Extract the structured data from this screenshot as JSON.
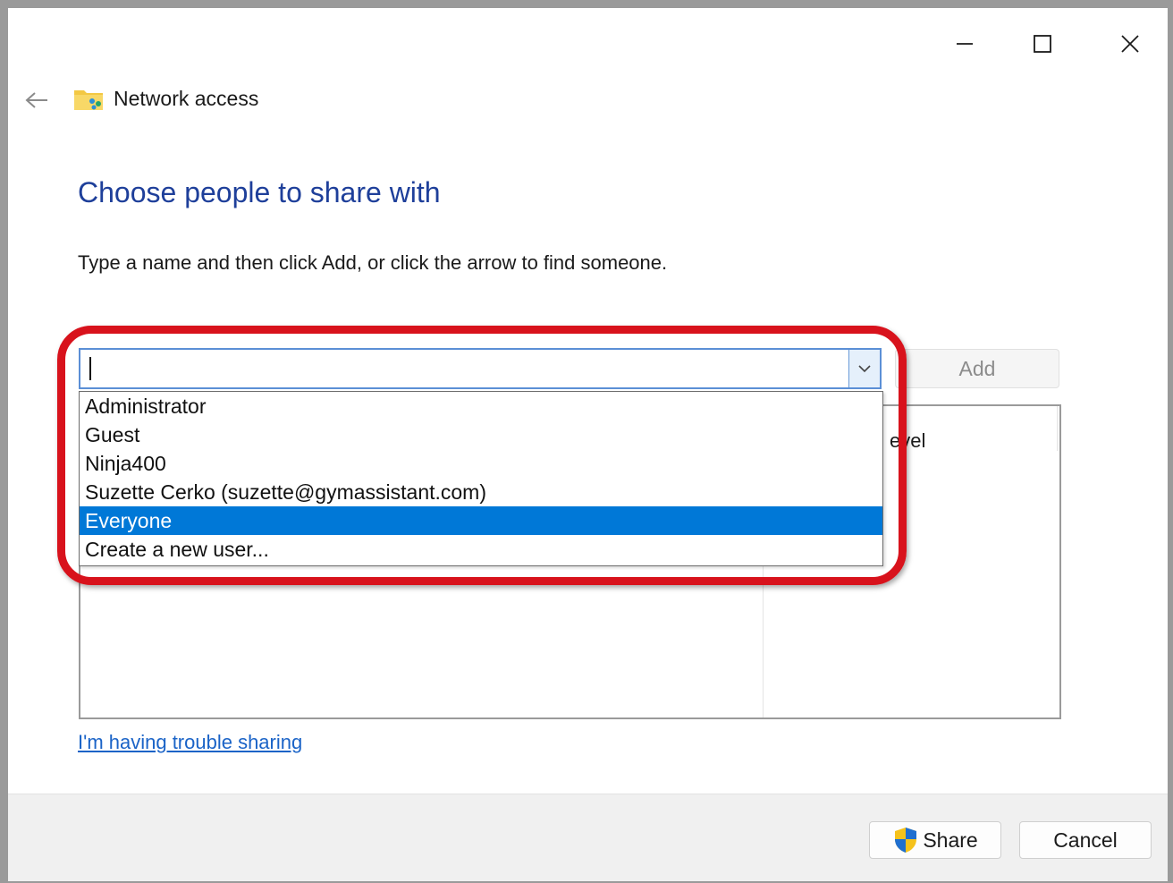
{
  "window": {
    "title": "Network access",
    "controls": {
      "minimize_icon": "minimize-icon",
      "maximize_icon": "maximize-icon",
      "close_icon": "close-icon"
    }
  },
  "nav": {
    "back_icon": "back-arrow-icon"
  },
  "main": {
    "heading": "Choose people to share with",
    "instruction": "Type a name and then click Add, or click the arrow to find someone.",
    "name_input": {
      "value": "",
      "placeholder": ""
    },
    "add_label": "Add",
    "dropdown_items": [
      {
        "label": "Administrator",
        "selected": false
      },
      {
        "label": "Guest",
        "selected": false
      },
      {
        "label": "Ninja400",
        "selected": false
      },
      {
        "label": "Suzette Cerko (suzette@gymassistant.com)",
        "selected": false
      },
      {
        "label": "Everyone",
        "selected": true
      },
      {
        "label": "Create a new user...",
        "selected": false
      }
    ],
    "permission_header_partial": "evel",
    "trouble_link": "I'm having trouble sharing"
  },
  "footer": {
    "share_label": "Share",
    "cancel_label": "Cancel"
  },
  "colors": {
    "heading": "#1e3f9a",
    "selection": "#0078d7",
    "highlight": "#d8121c",
    "link": "#1a63c7"
  }
}
